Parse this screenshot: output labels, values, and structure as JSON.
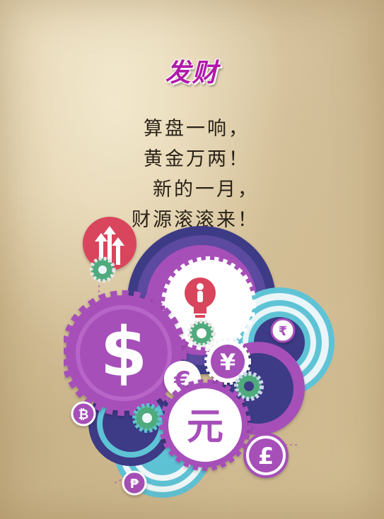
{
  "title": "发财",
  "poem": {
    "lines": [
      "算盘一响，",
      "黄金万两！",
      "新的一月，",
      "财源滚滚来！"
    ]
  },
  "illustration": {
    "icons": [
      "up-arrows-icon",
      "lightbulb-person-icon",
      "dollar-icon",
      "euro-icon",
      "yen-icon",
      "rupee-icon",
      "bitcoin-icon",
      "pound-icon",
      "peso-icon"
    ],
    "glyphs": {
      "dollar": "$",
      "euro": "€",
      "yen": "¥",
      "yuan": "元",
      "rupee": "₹",
      "bitcoin": "₿",
      "pound": "£",
      "peso": "₱"
    },
    "colors": {
      "purple": "#a64fb9",
      "navy": "#3d3a86",
      "teal": "#5fc3d6",
      "red": "#d9455c",
      "green": "#4faa7e"
    }
  }
}
